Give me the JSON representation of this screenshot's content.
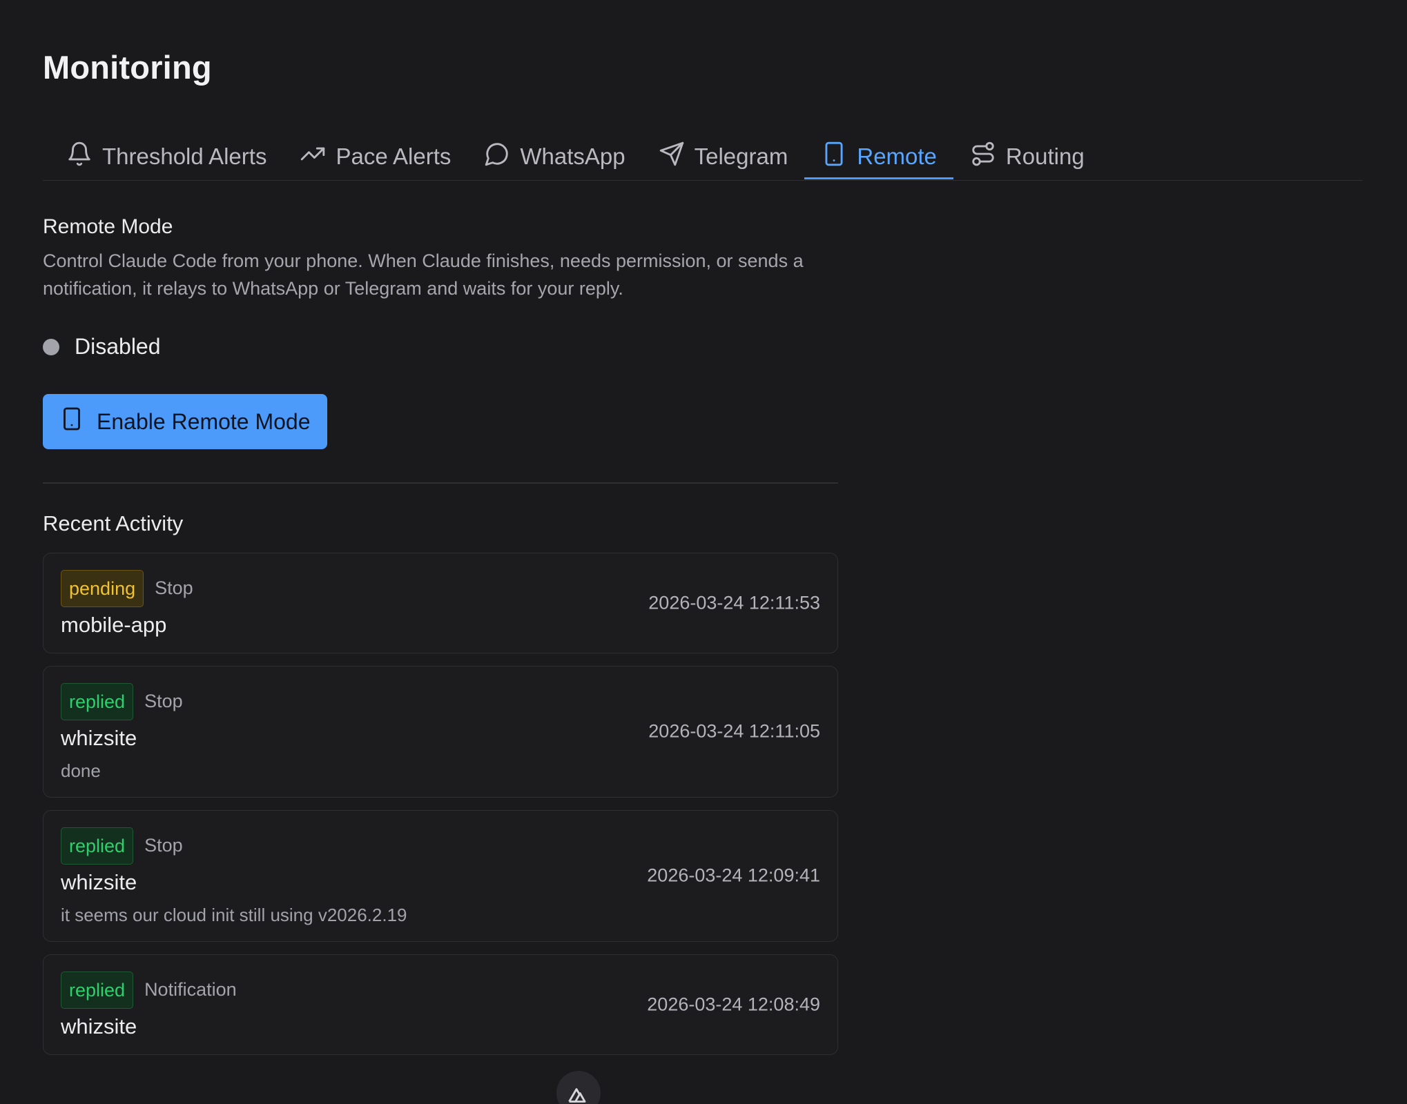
{
  "page": {
    "title": "Monitoring"
  },
  "tabs": [
    {
      "label": "Threshold Alerts",
      "icon": "bell-icon",
      "active": false
    },
    {
      "label": "Pace Alerts",
      "icon": "trending-up-icon",
      "active": false
    },
    {
      "label": "WhatsApp",
      "icon": "message-circle-icon",
      "active": false
    },
    {
      "label": "Telegram",
      "icon": "send-icon",
      "active": false
    },
    {
      "label": "Remote",
      "icon": "smartphone-icon",
      "active": true
    },
    {
      "label": "Routing",
      "icon": "route-icon",
      "active": false
    }
  ],
  "remote": {
    "title": "Remote Mode",
    "description": "Control Claude Code from your phone. When Claude finishes, needs permission, or sends a notification, it relays to WhatsApp or Telegram and waits for your reply.",
    "status": "Disabled",
    "enable_button": "Enable Remote Mode"
  },
  "activity": {
    "title": "Recent Activity",
    "items": [
      {
        "status": "pending",
        "event": "Stop",
        "project": "mobile-app",
        "reply": "",
        "time": "2026-03-24 12:11:53"
      },
      {
        "status": "replied",
        "event": "Stop",
        "project": "whizsite",
        "reply": "done",
        "time": "2026-03-24 12:11:05"
      },
      {
        "status": "replied",
        "event": "Stop",
        "project": "whizsite",
        "reply": "it seems our cloud init still using v2026.2.19",
        "time": "2026-03-24 12:09:41"
      },
      {
        "status": "replied",
        "event": "Notification",
        "project": "whizsite",
        "reply": "",
        "time": "2026-03-24 12:08:49"
      }
    ]
  },
  "colors": {
    "background": "#1a1a1c",
    "accent": "#4c9bfb",
    "pending": "#f1c232",
    "replied": "#2fcf6d"
  },
  "devtools": {
    "icon": "nuxt-logo-icon"
  }
}
